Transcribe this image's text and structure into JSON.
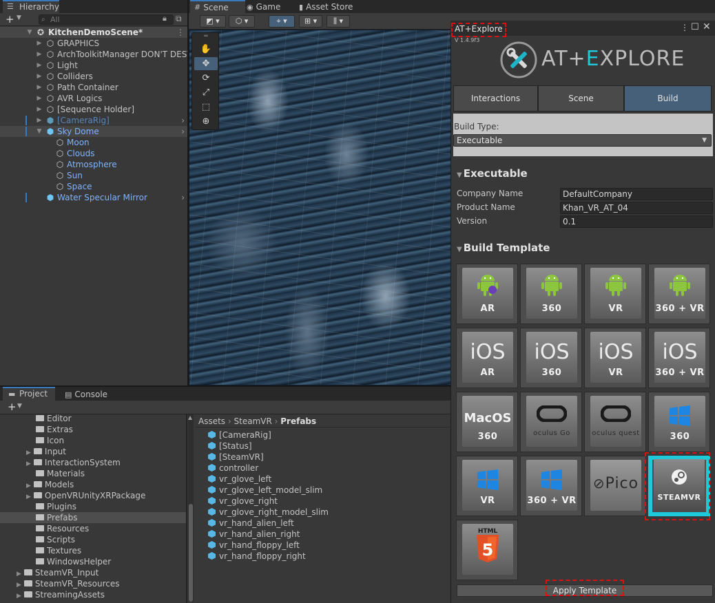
{
  "hierarchy": {
    "tab": "Hierarchy",
    "search_placeholder": "All",
    "scene_name": "KitchenDemoScene*",
    "items": [
      {
        "label": "GRAPHICS"
      },
      {
        "label": "ArchToolkitManager DON'T DEST"
      },
      {
        "label": "Light"
      },
      {
        "label": "Colliders"
      },
      {
        "label": "Path Container"
      },
      {
        "label": "AVR Logics"
      },
      {
        "label": "[Sequence Holder]"
      },
      {
        "label": "[CameraRig]"
      },
      {
        "label": "Sky Dome"
      },
      {
        "label": "Moon"
      },
      {
        "label": "Clouds"
      },
      {
        "label": "Atmosphere"
      },
      {
        "label": "Sun"
      },
      {
        "label": "Space"
      },
      {
        "label": "Water Specular Mirror"
      }
    ]
  },
  "scene": {
    "tabs": [
      "Scene",
      "Game",
      "Asset Store"
    ]
  },
  "project": {
    "tabs": [
      "Project",
      "Console"
    ],
    "breadcrumb": {
      "part1": "Assets",
      "part2": "SteamVR",
      "current": "Prefabs"
    },
    "folders": [
      "Editor",
      "Extras",
      "Icon",
      "Input",
      "InteractionSystem",
      "Materials",
      "Models",
      "OpenVRUnityXRPackage",
      "Plugins",
      "Prefabs",
      "Resources",
      "Scripts",
      "Textures",
      "WindowsHelper",
      "SteamVR_Input",
      "SteamVR_Resources",
      "StreamingAssets"
    ],
    "assets": [
      "[CameraRig]",
      "[Status]",
      "[SteamVR]",
      "controller",
      "vr_glove_left",
      "vr_glove_left_model_slim",
      "vr_glove_right",
      "vr_glove_right_model_slim",
      "vr_hand_alien_left",
      "vr_hand_alien_right",
      "vr_hand_floppy_left",
      "vr_hand_floppy_right"
    ]
  },
  "atx": {
    "title": "AT+Explore",
    "version": "V 1.4.9f3",
    "logo": {
      "part1": "AT+",
      "accent": "E",
      "part2": "XPLORE"
    },
    "tabs": [
      "Interactions",
      "Scene",
      "Build"
    ],
    "build_type_label": "Build Type:",
    "build_type_value": "Executable",
    "executable_header": "Executable",
    "fields": {
      "company_label": "Company Name",
      "company_value": "DefaultCompany",
      "product_label": "Product Name",
      "product_value": "Khan_VR_AT_04",
      "version_label": "Version",
      "version_value": "0.1"
    },
    "template_header": "Build Template",
    "templates": [
      {
        "label": "AR"
      },
      {
        "label": "360"
      },
      {
        "label": "VR"
      },
      {
        "label": "360 + VR"
      },
      {
        "label": "AR"
      },
      {
        "label": "360"
      },
      {
        "label": "VR"
      },
      {
        "label": "360 + VR"
      },
      {
        "label": "360"
      },
      {
        "label": "oculus Go"
      },
      {
        "label": "oculus quest"
      },
      {
        "label": "360"
      },
      {
        "label": "VR"
      },
      {
        "label": "360 + VR"
      },
      {
        "label": "Pico"
      },
      {
        "label": "STEAMVR"
      },
      {
        "label": "HTML"
      }
    ],
    "ios_text": "iOS",
    "macos_text": "MacOS",
    "html5_digit": "5",
    "apply_label": "Apply Template",
    "accent_color": "#1ec9d9",
    "highlight_color": "#dd1111"
  }
}
